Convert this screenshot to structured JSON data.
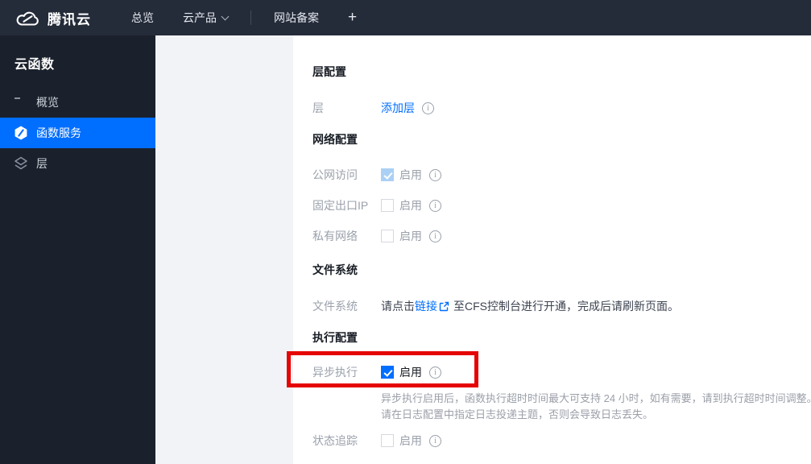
{
  "topbar": {
    "brand": "腾讯云",
    "nav": [
      {
        "label": "总览"
      },
      {
        "label": "云产品"
      },
      {
        "label": "网站备案"
      },
      {
        "label": "+"
      }
    ]
  },
  "sidebar": {
    "title": "云函数",
    "items": [
      {
        "label": "概览"
      },
      {
        "label": "函数服务"
      },
      {
        "label": "层"
      }
    ]
  },
  "content": {
    "section_layer": {
      "title": "层配置",
      "row": {
        "label": "层",
        "link": "添加层"
      }
    },
    "section_network": {
      "title": "网络配置",
      "rows": [
        {
          "label": "公网访问",
          "enable": "启用",
          "checked": true,
          "disabled": true
        },
        {
          "label": "固定出口IP",
          "enable": "启用",
          "checked": false
        },
        {
          "label": "私有网络",
          "enable": "启用",
          "checked": false
        }
      ]
    },
    "section_fs": {
      "title": "文件系统",
      "row": {
        "label": "文件系统",
        "text_before": "请点击",
        "link": "链接",
        "text_after": "至CFS控制台进行开通，完成后请刷新页面。"
      }
    },
    "section_exec": {
      "title": "执行配置",
      "row_async": {
        "label": "异步执行",
        "enable": "启用",
        "checked": true
      },
      "help_line1": "异步执行启用后，函数执行超时时间最大可支持 24 小时，如有需要，请到执行超时时间调整。",
      "help_line2": "请在日志配置中指定日志投递主题，否则会导致日志丢失。",
      "row_trace": {
        "label": "状态追踪",
        "enable": "启用",
        "checked": false
      }
    }
  },
  "colors": {
    "accent": "#006eff",
    "annotation_red": "#e60505",
    "disabled_checked": "#abd0f5",
    "topbar_bg": "#242b39",
    "sidebar_bg": "#1b212c"
  }
}
